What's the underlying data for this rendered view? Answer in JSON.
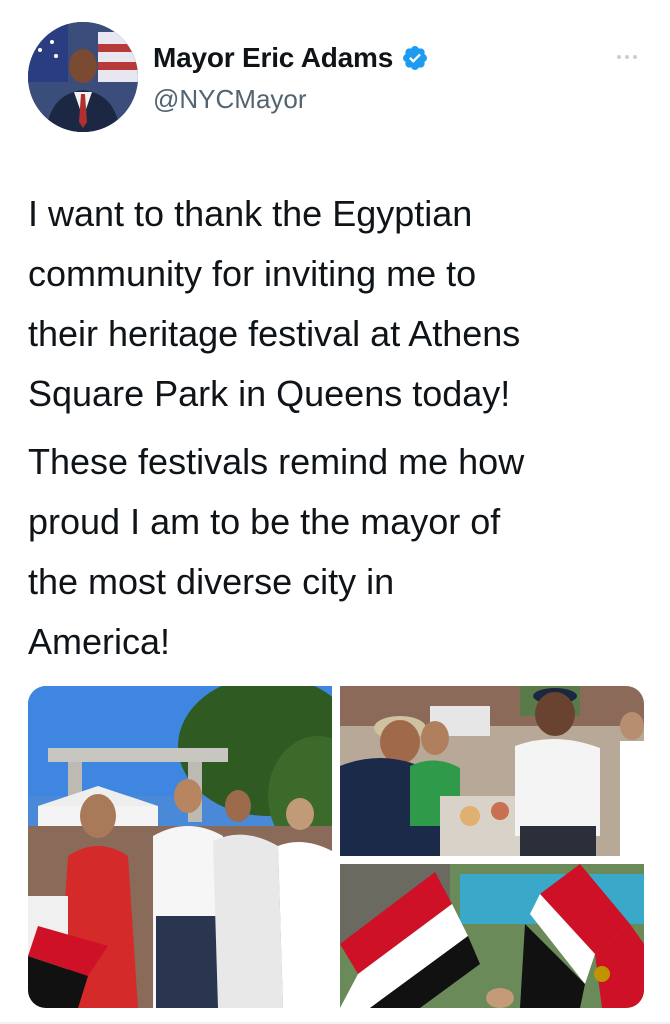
{
  "author": {
    "display_name": "Mayor Eric Adams",
    "handle": "@NYCMayor",
    "verified": true,
    "avatar_icon": "profile-photo",
    "verified_badge_color": "#1d9bf0"
  },
  "tweet": {
    "paragraphs": [
      "I want to thank the Egyptian\ncommunity for inviting me to\ntheir heritage festival at Athens\nSquare Park in Queens today!",
      "These festivals remind me how\nproud I am to be the mayor of\nthe most diverse city in\nAmerica!"
    ]
  },
  "media": {
    "photos": [
      {
        "description_icon": "festival-crowd-photo"
      },
      {
        "description_icon": "food-table-photo"
      },
      {
        "description_icon": "egyptian-flags-photo"
      }
    ]
  },
  "colors": {
    "text": "#0f1419",
    "secondary_text": "#536471",
    "accent": "#1d9bf0",
    "flag_red": "#ce1126",
    "flag_white": "#ffffff",
    "flag_black": "#000000",
    "eagle_gold": "#c09300"
  }
}
